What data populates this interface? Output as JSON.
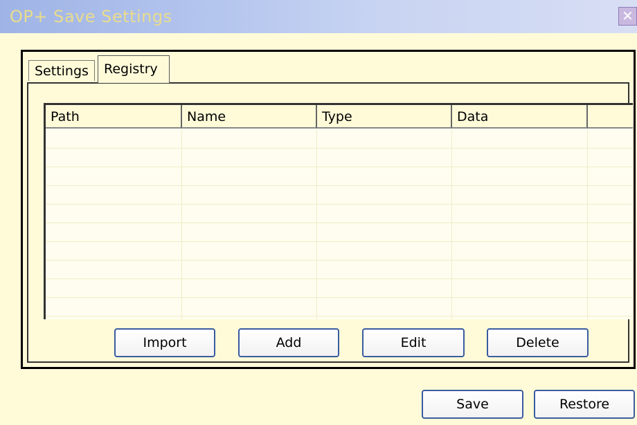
{
  "window": {
    "title": "OP+ Save Settings",
    "close_symbol": "✕"
  },
  "tabs": [
    {
      "label": "Settings",
      "selected": false
    },
    {
      "label": "Registry",
      "selected": true
    }
  ],
  "table": {
    "columns": [
      "Path",
      "Name",
      "Type",
      "Data",
      ""
    ],
    "rows": []
  },
  "registry_actions": {
    "import_label": "Import",
    "add_label": "Add",
    "edit_label": "Edit",
    "delete_label": "Delete"
  },
  "footer": {
    "save_label": "Save",
    "restore_label": "Restore"
  }
}
